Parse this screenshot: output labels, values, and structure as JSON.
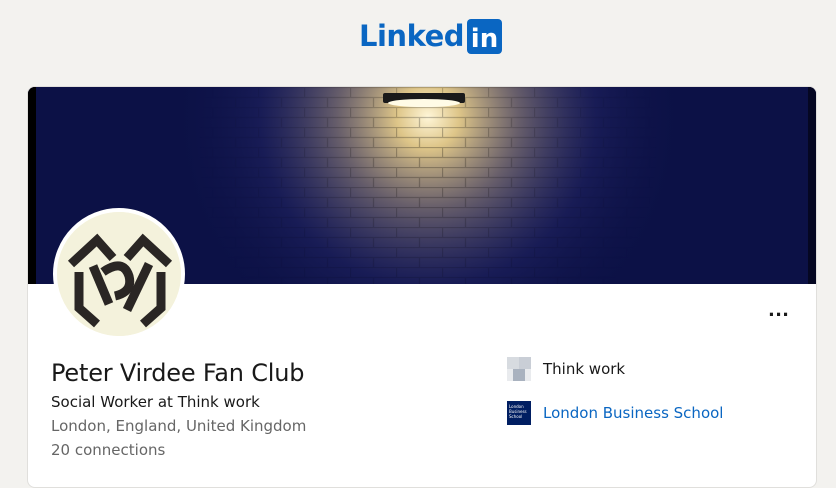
{
  "header": {
    "logo_text": "Linked",
    "logo_box_text": "in"
  },
  "profile": {
    "name": "Peter Virdee Fan Club",
    "headline": "Social Worker at Think work",
    "location": "London, England, United Kingdom",
    "connections": "20 connections",
    "more_label": "..."
  },
  "experience": [
    {
      "label": "Think work",
      "icon": "company-logo"
    },
    {
      "label": "London Business School",
      "icon": "school-logo",
      "logo_text": "London Business School"
    }
  ],
  "colors": {
    "brand": "#0a66c2",
    "banner": "#0c1146",
    "page_bg": "#f3f2ef"
  }
}
